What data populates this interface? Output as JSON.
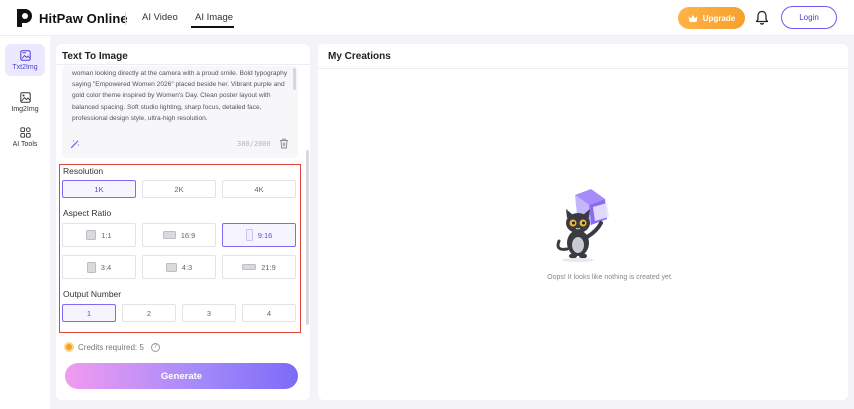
{
  "header": {
    "brand": "HitPaw Online",
    "tabs": [
      {
        "label": "AI Video"
      },
      {
        "label": "AI Image"
      }
    ],
    "upgrade_label": "Upgrade",
    "login_label": "Login"
  },
  "rail": {
    "items": [
      {
        "label": "Txt2Img",
        "icon": "text-to-image-icon"
      },
      {
        "label": "Img2Img",
        "icon": "image-to-image-icon"
      },
      {
        "label": "AI Tools",
        "icon": "grid-icon"
      }
    ]
  },
  "left_panel": {
    "title": "Text To Image",
    "prompt": "woman looking directly at the camera with a proud smile. Bold typography saying \"Empowered Women 2026\" placed beside her. Vibrant purple and gold color theme inspired by Women's Day. Clean poster layout with balanced spacing. Soft studio lighting, sharp focus, detailed face, professional design style, ultra-high resolution.",
    "char_count": "380/2000",
    "resolution": {
      "label": "Resolution",
      "options": [
        "1K",
        "2K",
        "4K"
      ],
      "selected": "1K"
    },
    "aspect_ratio": {
      "label": "Aspect Ratio",
      "options": [
        "1:1",
        "16:9",
        "9:16",
        "3:4",
        "4:3",
        "21:9"
      ],
      "selected": "9:16"
    },
    "output_number": {
      "label": "Output Number",
      "options": [
        "1",
        "2",
        "3",
        "4"
      ],
      "selected": "1"
    },
    "credits": "Credits required: 5",
    "help_glyph": "?",
    "generate_label": "Generate"
  },
  "right_panel": {
    "title": "My Creations",
    "empty_message": "Oops! It looks like nothing is created yet."
  },
  "colors": {
    "accent": "#6b5cf6",
    "upgrade": "#f5a02d",
    "highlight_frame": "#e0453b"
  }
}
